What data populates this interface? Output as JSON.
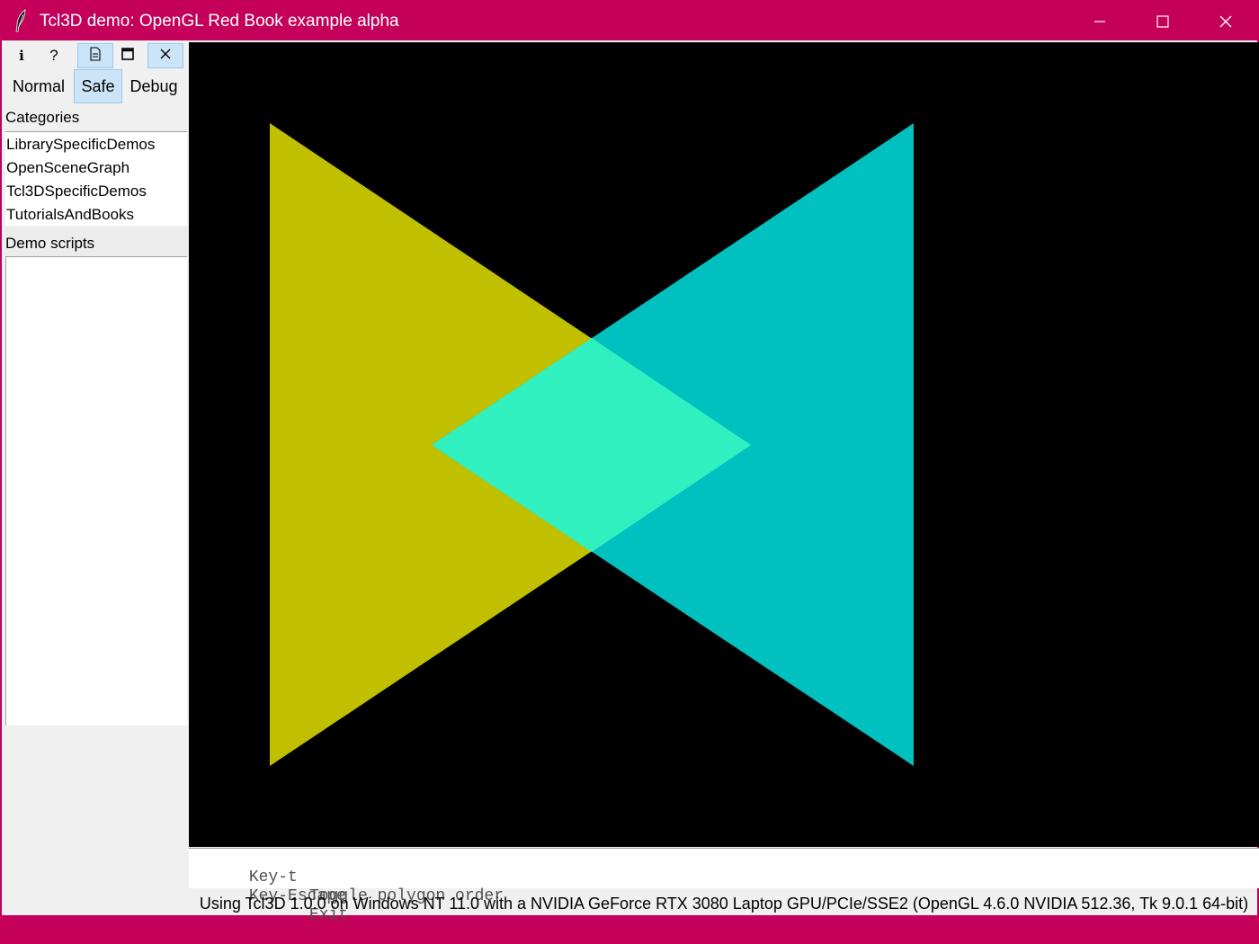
{
  "window": {
    "title": "Tcl3D demo: OpenGL Red Book example alpha",
    "app_icon": "feather-icon",
    "controls": [
      "minimize-icon",
      "maximize-icon",
      "close-icon"
    ]
  },
  "toolbar": {
    "buttons": [
      {
        "icon": "info-icon",
        "glyph": "i"
      },
      {
        "icon": "help-icon",
        "glyph": "?"
      },
      {
        "icon": "document-icon"
      },
      {
        "icon": "window-icon"
      },
      {
        "icon": "close-icon"
      }
    ]
  },
  "modes": {
    "normal": "Normal",
    "safe": "Safe",
    "debug": "Debug",
    "selected": "Safe"
  },
  "sidebar": {
    "categories_label": "Categories",
    "categories": [
      "LibrarySpecificDemos",
      "OpenSceneGraph",
      "Tcl3DSpecificDemos",
      "TutorialsAndBooks"
    ],
    "demo_scripts_label": "Demo scripts",
    "demo_scripts": []
  },
  "canvas": {
    "background": "#000000",
    "left_triangle_color": "#c0c000",
    "right_triangle_color": "#00c0c0",
    "overlap_color": "#30f0c0"
  },
  "key_help": [
    {
      "key": "Key-t",
      "action": "Toggle polygon order"
    },
    {
      "key": "Key-Escape",
      "action": "Exit"
    }
  ],
  "status": "Using Tcl3D 1.0.0 on Windows NT 11.0 with a NVIDIA GeForce RTX 3080 Laptop GPU/PCIe/SSE2 (OpenGL 4.6.0 NVIDIA 512.36, Tk 9.0.1 64-bit)",
  "colors": {
    "titlebar": "#c4005a",
    "selection": "#cce4f7",
    "panel": "#f0f0f0"
  }
}
